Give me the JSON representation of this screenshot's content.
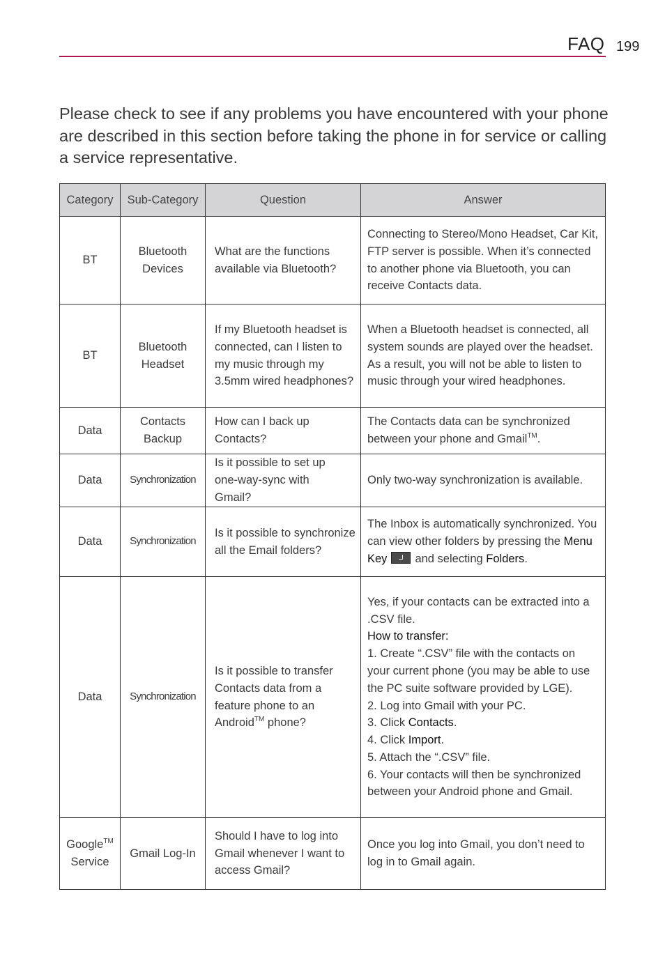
{
  "header": {
    "section_title": "FAQ",
    "page_number": "199",
    "accent_color": "#b0164f"
  },
  "intro": "Please check to see if any problems you have encountered with your phone are described in this section before taking the phone in for service or calling a service representative.",
  "table": {
    "columns": [
      "Category",
      "Sub-Category",
      "Question",
      "Answer"
    ],
    "rows": [
      {
        "category": "BT",
        "subcategory": "Bluetooth Devices",
        "question": "What are the functions available via Bluetooth?",
        "answer": "Connecting to Stereo/Mono Headset, Car Kit, FTP server is possible. When it’s connected to another phone via Bluetooth, you can receive Contacts data."
      },
      {
        "category": "BT",
        "subcategory": "Bluetooth Headset",
        "question": "If my Bluetooth headset is connected, can I listen to my music through my 3.5mm wired headphones?",
        "answer": "When a Bluetooth headset is connected, all system sounds are played over the headset. As a result, you will not be able to listen to music through your wired headphones."
      },
      {
        "category": "Data",
        "subcategory": "Contacts Backup",
        "question": "How can I back up Contacts?",
        "answer": "The Contacts data can be synchronized between your phone and Gmail",
        "answer_tm": "TM",
        "answer_end": "."
      },
      {
        "category": "Data",
        "subcategory": "Synchronization",
        "question": "Is it possible to set up one-way-sync with Gmail?",
        "answer": "Only two-way synchronization is available."
      },
      {
        "category": "Data",
        "subcategory": "Synchronization",
        "question": "Is it possible to synchronize all the Email folders?",
        "answer_part1": "The Inbox is automatically synchronized. You can view other folders by pressing the",
        "answer_key": "Menu Key",
        "answer_key_icon": "menu-key-icon",
        "answer_part2": "and selecting",
        "answer_folders": "Folders",
        "answer_end": "."
      },
      {
        "category": "Data",
        "subcategory": "Synchronization",
        "question": "Is it possible to transfer Contacts data from a feature phone to an Android",
        "question_tm": "TM",
        "question_end": " phone?",
        "answer_intro": "Yes, if your contacts can be extracted into a .CSV file.",
        "answer_howto": "How to transfer:",
        "steps": {
          "s1": "1. Create “.CSV” file with the contacts on your current phone (you may be able to use the PC suite software provided by LGE).",
          "s2": "2. Log into Gmail with your PC.",
          "s3_pre": "3. Click ",
          "s3_bold": "Contacts",
          "s4_pre": "4. Click ",
          "s4_bold": "Import",
          "s5": "5. Attach the “.CSV” file.",
          "s6": "6. Your contacts will then be synchronized between your Android phone and Gmail."
        }
      },
      {
        "category": "Google",
        "category_tm": "TM",
        "category_line2": "Service",
        "subcategory": "Gmail Log-In",
        "question": "Should I have to log into Gmail whenever I want to access Gmail?",
        "answer": "Once you log into Gmail, you don’t need to log in to Gmail again."
      }
    ]
  }
}
